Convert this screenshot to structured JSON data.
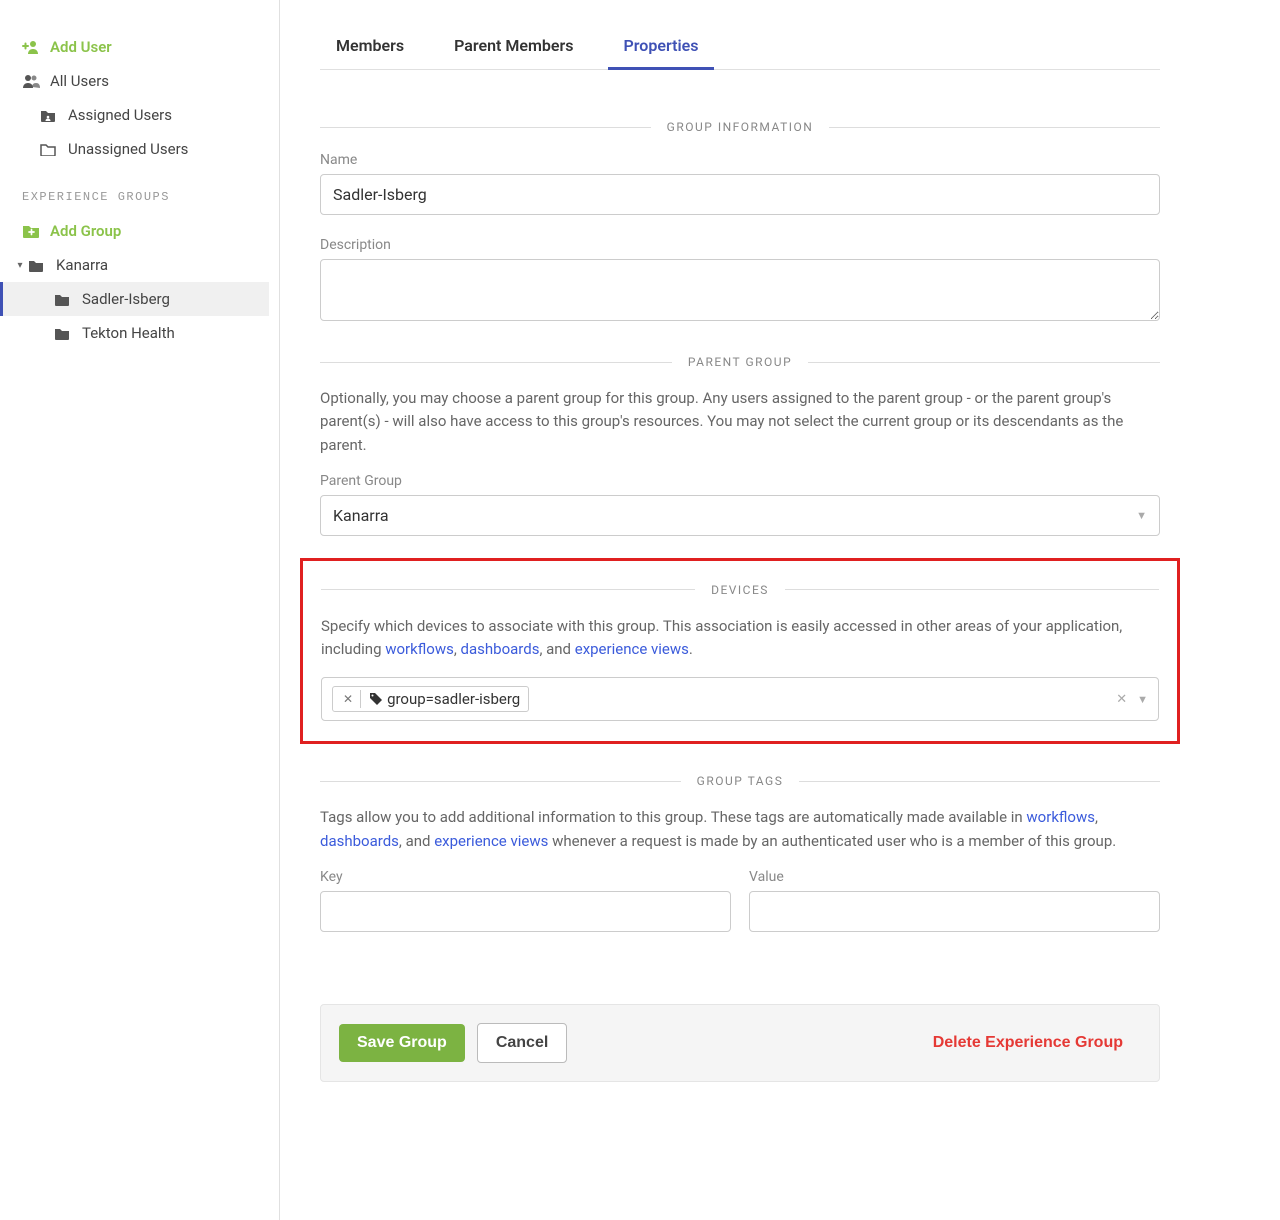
{
  "sidebar": {
    "add_user": "Add User",
    "all_users": "All Users",
    "assigned_users": "Assigned Users",
    "unassigned_users": "Unassigned Users",
    "groups_header": "EXPERIENCE GROUPS",
    "add_group": "Add Group",
    "tree": {
      "kanarra": "Kanarra",
      "sadler_isberg": "Sadler-Isberg",
      "tekton_health": "Tekton Health"
    }
  },
  "tabs": {
    "members": "Members",
    "parent_members": "Parent Members",
    "properties": "Properties"
  },
  "sections": {
    "group_info": "GROUP INFORMATION",
    "parent_group": "PARENT GROUP",
    "devices": "DEVICES",
    "group_tags": "GROUP TAGS"
  },
  "labels": {
    "name": "Name",
    "description": "Description",
    "parent_group": "Parent Group",
    "key": "Key",
    "value": "Value"
  },
  "values": {
    "name": "Sadler-Isberg",
    "description": "",
    "parent_group": "Kanarra",
    "device_tag": "group=sadler-isberg"
  },
  "descriptions": {
    "parent_group": "Optionally, you may choose a parent group for this group. Any users assigned to the parent group - or the parent group's parent(s) - will also have access to this group's resources. You may not select the current group or its descendants as the parent.",
    "devices_pre": "Specify which devices to associate with this group. This association is easily accessed in other areas of your application, including ",
    "devices_link1": "workflows",
    "devices_link2": "dashboards",
    "devices_link3": "experience views",
    "tags_pre": "Tags allow you to add additional information to this group. These tags are automatically made available in ",
    "tags_link1": "workflows",
    "tags_link2": "dashboards",
    "tags_link3": "experience views",
    "tags_post": " whenever a request is made by an authenticated user who is a member of this group."
  },
  "buttons": {
    "save": "Save Group",
    "cancel": "Cancel",
    "delete": "Delete Experience Group"
  }
}
